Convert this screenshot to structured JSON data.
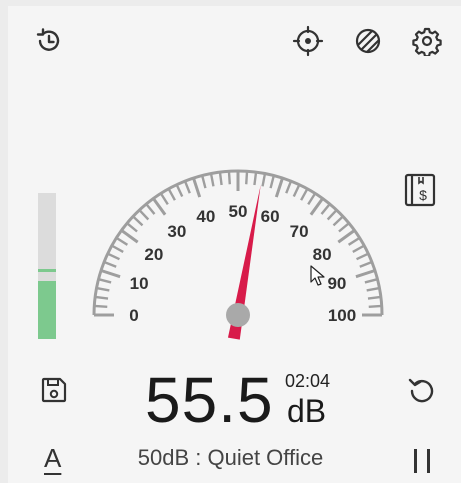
{
  "toolbar": {
    "history_icon": "clock-rewind-icon",
    "location_icon": "crosshair-icon",
    "theme_icon": "striped-circle-icon",
    "settings_icon": "gear-icon"
  },
  "side": {
    "calibrate_icon": "dollar-book-icon",
    "save_icon": "floppy-disk-icon",
    "reset_icon": "reset-arrow-icon",
    "pause_icon": "pause-icon"
  },
  "level_meter": {
    "level_percent": 40,
    "peak_percent": 46,
    "fill_color": "#7dc98e",
    "track_color": "#dcdcdc"
  },
  "gauge": {
    "min": 0,
    "max": 100,
    "value": 55.5,
    "tick_labels": [
      "0",
      "10",
      "20",
      "30",
      "40",
      "50",
      "60",
      "70",
      "80",
      "90",
      "100"
    ],
    "needle_color": "#d81b4a",
    "tick_color": "#9e9e9e"
  },
  "reading": {
    "value": "55.5",
    "unit": "dB",
    "elapsed": "02:04"
  },
  "status": {
    "description": "50dB : Quiet Office"
  },
  "weighting": {
    "label": "A"
  }
}
